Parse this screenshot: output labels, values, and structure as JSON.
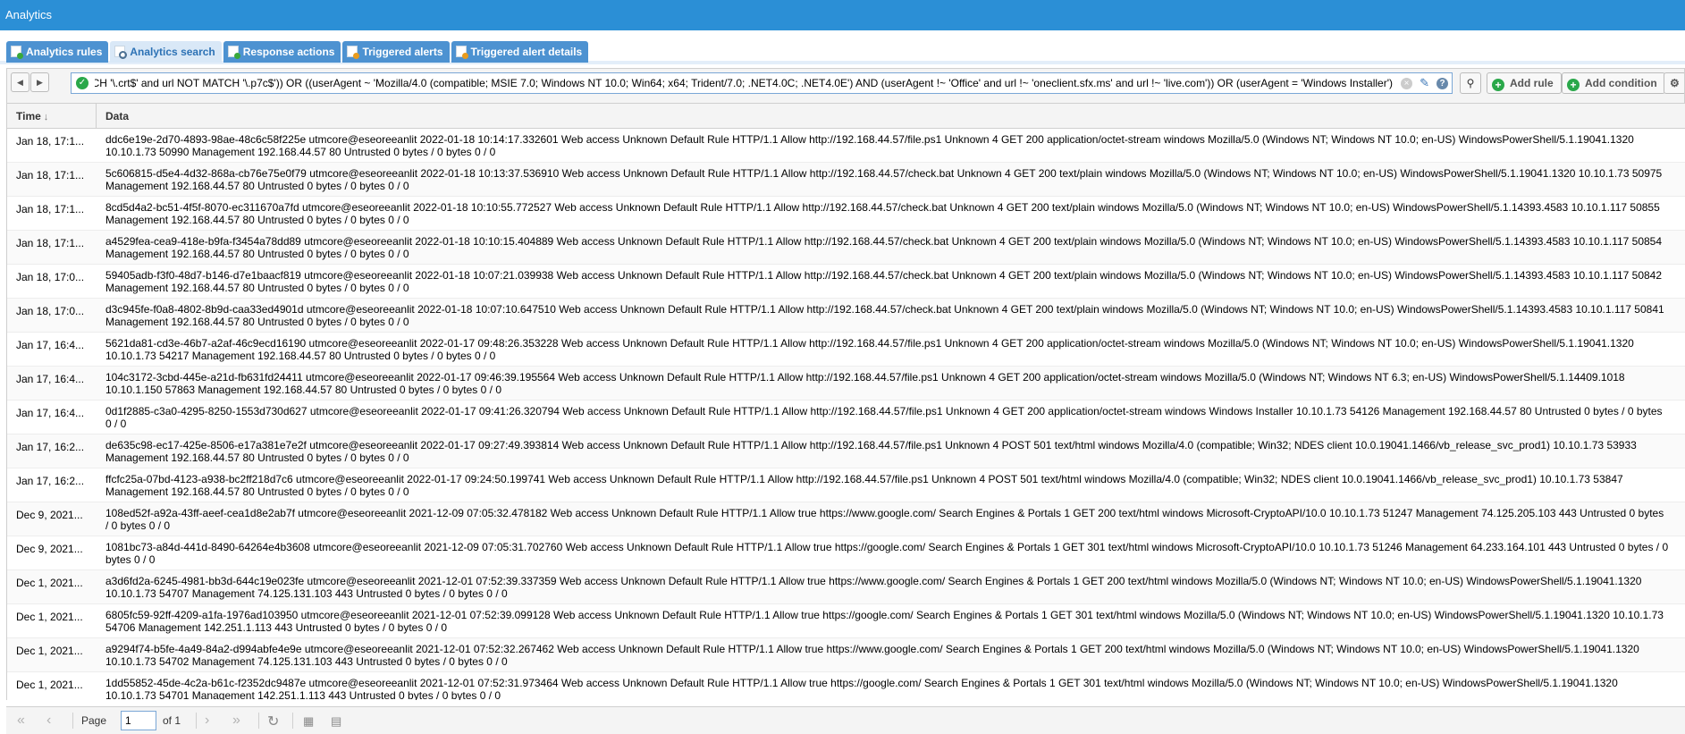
{
  "app": {
    "title": "Analytics"
  },
  "tabs": [
    {
      "label": "Analytics rules",
      "icon": "rules-icon",
      "active": false
    },
    {
      "label": "Analytics search",
      "icon": "search-doc-icon",
      "active": true
    },
    {
      "label": "Response actions",
      "icon": "actions-icon",
      "active": false
    },
    {
      "label": "Triggered alerts",
      "icon": "alert-icon",
      "active": false
    },
    {
      "label": "Triggered alert details",
      "icon": "alert-details-icon",
      "active": false
    }
  ],
  "toolbar": {
    "query": "url MATCH '\\.crt$' and url NOT MATCH '\\.p7c$')) OR ((userAgent ~ 'Mozilla/4.0 (compatible; MSIE 7.0; Windows NT 10.0; Win64; x64; Trident/7.0; .NET4.0C; .NET4.0E') AND (userAgent !~ 'Office' and url !~ 'oneclient.sfx.ms' and url !~ 'live.com')) OR (userAgent = 'Windows Installer')",
    "add_rule": "Add rule",
    "add_condition": "Add condition"
  },
  "grid": {
    "columns": {
      "time": "Time",
      "data": "Data"
    },
    "rows": [
      {
        "time": "Jan 18, 17:1...",
        "data": "ddc6e19e-2d70-4893-98ae-48c6c58f225e utmcore@eseoreeanlit 2022-01-18 10:14:17.332601 Web access Unknown Default Rule HTTP/1.1 Allow http://192.168.44.57/file.ps1 Unknown 4 GET 200 application/octet-stream windows Mozilla/5.0 (Windows NT; Windows NT 10.0; en-US) WindowsPowerShell/5.1.19041.1320 10.10.1.73 50990 Management 192.168.44.57 80 Untrusted 0 bytes / 0 bytes 0 / 0"
      },
      {
        "time": "Jan 18, 17:1...",
        "data": "5c606815-d5e4-4d32-868a-cb76e75e0f79 utmcore@eseoreeanlit 2022-01-18 10:13:37.536910 Web access Unknown Default Rule HTTP/1.1 Allow http://192.168.44.57/check.bat Unknown 4 GET 200 text/plain windows Mozilla/5.0 (Windows NT; Windows NT 10.0; en-US) WindowsPowerShell/5.1.19041.1320 10.10.1.73 50975 Management 192.168.44.57 80 Untrusted 0 bytes / 0 bytes 0 / 0"
      },
      {
        "time": "Jan 18, 17:1...",
        "data": "8cd5d4a2-bc51-4f5f-8070-ec311670a7fd utmcore@eseoreeanlit 2022-01-18 10:10:55.772527 Web access Unknown Default Rule HTTP/1.1 Allow http://192.168.44.57/check.bat Unknown 4 GET 200 text/plain windows Mozilla/5.0 (Windows NT; Windows NT 10.0; en-US) WindowsPowerShell/5.1.14393.4583 10.10.1.117 50855 Management 192.168.44.57 80 Untrusted 0 bytes / 0 bytes 0 / 0"
      },
      {
        "time": "Jan 18, 17:1...",
        "data": "a4529fea-cea9-418e-b9fa-f3454a78dd89 utmcore@eseoreeanlit 2022-01-18 10:10:15.404889 Web access Unknown Default Rule HTTP/1.1 Allow http://192.168.44.57/check.bat Unknown 4 GET 200 text/plain windows Mozilla/5.0 (Windows NT; Windows NT 10.0; en-US) WindowsPowerShell/5.1.14393.4583 10.10.1.117 50854 Management 192.168.44.57 80 Untrusted 0 bytes / 0 bytes 0 / 0"
      },
      {
        "time": "Jan 18, 17:0...",
        "data": "59405adb-f3f0-48d7-b146-d7e1baacf819 utmcore@eseoreeanlit 2022-01-18 10:07:21.039938 Web access Unknown Default Rule HTTP/1.1 Allow http://192.168.44.57/check.bat Unknown 4 GET 200 text/plain windows Mozilla/5.0 (Windows NT; Windows NT 10.0; en-US) WindowsPowerShell/5.1.14393.4583 10.10.1.117 50842 Management 192.168.44.57 80 Untrusted 0 bytes / 0 bytes 0 / 0"
      },
      {
        "time": "Jan 18, 17:0...",
        "data": "d3c945fe-f0a8-4802-8b9d-caa33ed4901d utmcore@eseoreeanlit 2022-01-18 10:07:10.647510 Web access Unknown Default Rule HTTP/1.1 Allow http://192.168.44.57/check.bat Unknown 4 GET 200 text/plain windows Mozilla/5.0 (Windows NT; Windows NT 10.0; en-US) WindowsPowerShell/5.1.14393.4583 10.10.1.117 50841 Management 192.168.44.57 80 Untrusted 0 bytes / 0 bytes 0 / 0"
      },
      {
        "time": "Jan 17, 16:4...",
        "data": "5621da81-cd3e-46b7-a2af-46c9ecd16190 utmcore@eseoreeanlit 2022-01-17 09:48:26.353228 Web access Unknown Default Rule HTTP/1.1 Allow http://192.168.44.57/file.ps1 Unknown 4 GET 200 application/octet-stream windows Mozilla/5.0 (Windows NT; Windows NT 10.0; en-US) WindowsPowerShell/5.1.19041.1320 10.10.1.73 54217 Management 192.168.44.57 80 Untrusted 0 bytes / 0 bytes 0 / 0"
      },
      {
        "time": "Jan 17, 16:4...",
        "data": "104c3172-3cbd-445e-a21d-fb631fd24411 utmcore@eseoreeanlit 2022-01-17 09:46:39.195564 Web access Unknown Default Rule HTTP/1.1 Allow http://192.168.44.57/file.ps1 Unknown 4 GET 200 application/octet-stream windows Mozilla/5.0 (Windows NT; Windows NT 6.3; en-US) WindowsPowerShell/5.1.14409.1018 10.10.1.150 57863 Management 192.168.44.57 80 Untrusted 0 bytes / 0 bytes 0 / 0"
      },
      {
        "time": "Jan 17, 16:4...",
        "data": "0d1f2885-c3a0-4295-8250-1553d730d627 utmcore@eseoreeanlit 2022-01-17 09:41:26.320794 Web access Unknown Default Rule HTTP/1.1 Allow http://192.168.44.57/file.ps1 Unknown 4 GET 200 application/octet-stream windows Windows Installer 10.10.1.73 54126 Management 192.168.44.57 80 Untrusted 0 bytes / 0 bytes 0 / 0"
      },
      {
        "time": "Jan 17, 16:2...",
        "data": "de635c98-ec17-425e-8506-e17a381e7e2f utmcore@eseoreeanlit 2022-01-17 09:27:49.393814 Web access Unknown Default Rule HTTP/1.1 Allow http://192.168.44.57/file.ps1 Unknown 4 POST 501 text/html windows Mozilla/4.0 (compatible; Win32; NDES client 10.0.19041.1466/vb_release_svc_prod1) 10.10.1.73 53933 Management 192.168.44.57 80 Untrusted 0 bytes / 0 bytes 0 / 0"
      },
      {
        "time": "Jan 17, 16:2...",
        "data": "ffcfc25a-07bd-4123-a938-bc2ff218d7c6 utmcore@eseoreeanlit 2022-01-17 09:24:50.199741 Web access Unknown Default Rule HTTP/1.1 Allow http://192.168.44.57/file.ps1 Unknown 4 POST 501 text/html windows Mozilla/4.0 (compatible; Win32; NDES client 10.0.19041.1466/vb_release_svc_prod1) 10.10.1.73 53847 Management 192.168.44.57 80 Untrusted 0 bytes / 0 bytes 0 / 0"
      },
      {
        "time": "Dec 9, 2021...",
        "data": "108ed52f-a92a-43ff-aeef-cea1d8e2ab7f utmcore@eseoreeanlit 2021-12-09 07:05:32.478182 Web access Unknown Default Rule HTTP/1.1 Allow true https://www.google.com/ Search Engines & Portals 1 GET 200 text/html windows Microsoft-CryptoAPI/10.0 10.10.1.73 51247 Management 74.125.205.103 443 Untrusted 0 bytes / 0 bytes 0 / 0"
      },
      {
        "time": "Dec 9, 2021...",
        "data": "1081bc73-a84d-441d-8490-64264e4b3608 utmcore@eseoreeanlit 2021-12-09 07:05:31.702760 Web access Unknown Default Rule HTTP/1.1 Allow true https://google.com/ Search Engines & Portals 1 GET 301 text/html windows Microsoft-CryptoAPI/10.0 10.10.1.73 51246 Management 64.233.164.101 443 Untrusted 0 bytes / 0 bytes 0 / 0"
      },
      {
        "time": "Dec 1, 2021...",
        "data": "a3d6fd2a-6245-4981-bb3d-644c19e023fe utmcore@eseoreeanlit 2021-12-01 07:52:39.337359 Web access Unknown Default Rule HTTP/1.1 Allow true https://www.google.com/ Search Engines & Portals 1 GET 200 text/html windows Mozilla/5.0 (Windows NT; Windows NT 10.0; en-US) WindowsPowerShell/5.1.19041.1320 10.10.1.73 54707 Management 74.125.131.103 443 Untrusted 0 bytes / 0 bytes 0 / 0"
      },
      {
        "time": "Dec 1, 2021...",
        "data": "6805fc59-92ff-4209-a1fa-1976ad103950 utmcore@eseoreeanlit 2021-12-01 07:52:39.099128 Web access Unknown Default Rule HTTP/1.1 Allow true https://google.com/ Search Engines & Portals 1 GET 301 text/html windows Mozilla/5.0 (Windows NT; Windows NT 10.0; en-US) WindowsPowerShell/5.1.19041.1320 10.10.1.73 54706 Management 142.251.1.113 443 Untrusted 0 bytes / 0 bytes 0 / 0"
      },
      {
        "time": "Dec 1, 2021...",
        "data": "a9294f74-b5fe-4a49-84a2-d994abfe4e9e utmcore@eseoreeanlit 2021-12-01 07:52:32.267462 Web access Unknown Default Rule HTTP/1.1 Allow true https://www.google.com/ Search Engines & Portals 1 GET 200 text/html windows Mozilla/5.0 (Windows NT; Windows NT 10.0; en-US) WindowsPowerShell/5.1.19041.1320 10.10.1.73 54702 Management 74.125.131.103 443 Untrusted 0 bytes / 0 bytes 0 / 0"
      },
      {
        "time": "Dec 1, 2021...",
        "data": "1dd55852-45de-4c2a-b61c-f2352dc9487e utmcore@eseoreeanlit 2021-12-01 07:52:31.973464 Web access Unknown Default Rule HTTP/1.1 Allow true https://google.com/ Search Engines & Portals 1 GET 301 text/html windows Mozilla/5.0 (Windows NT; Windows NT 10.0; en-US) WindowsPowerShell/5.1.19041.1320 10.10.1.73 54701 Management 142.251.1.113 443 Untrusted 0 bytes / 0 bytes 0 / 0"
      }
    ]
  },
  "pager": {
    "page_label": "Page",
    "current_page": "1",
    "of_label": "of 1"
  }
}
